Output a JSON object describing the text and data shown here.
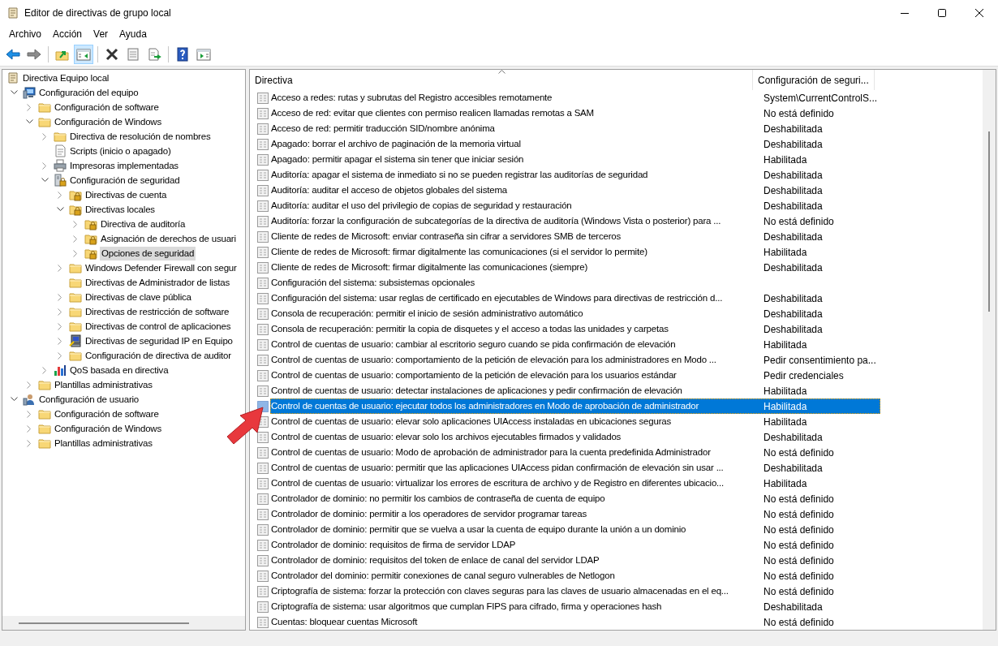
{
  "window": {
    "title": "Editor de directivas de grupo local"
  },
  "menu": [
    "Archivo",
    "Acción",
    "Ver",
    "Ayuda"
  ],
  "toolbar": [
    {
      "kind": "back",
      "pressed": false
    },
    {
      "kind": "forward",
      "pressed": false
    },
    {
      "kind": "sep"
    },
    {
      "kind": "up",
      "pressed": false
    },
    {
      "kind": "tree",
      "pressed": true
    },
    {
      "kind": "sep"
    },
    {
      "kind": "delete",
      "pressed": false
    },
    {
      "kind": "properties",
      "pressed": false
    },
    {
      "kind": "export",
      "pressed": false
    },
    {
      "kind": "sep"
    },
    {
      "kind": "help",
      "pressed": false
    },
    {
      "kind": "action",
      "pressed": false
    }
  ],
  "tree": [
    {
      "label": "Directiva Equipo local",
      "kind": "scroll",
      "selected": false,
      "children": [
        {
          "label": "Configuración del equipo",
          "kind": "computer",
          "expanded": true,
          "selected": false,
          "children": [
            {
              "label": "Configuración de software",
              "kind": "folder",
              "expanded": false,
              "selected": false
            },
            {
              "label": "Configuración de Windows",
              "kind": "folder",
              "expanded": true,
              "selected": false,
              "children": [
                {
                  "label": "Directiva de resolución de nombres",
                  "kind": "folder",
                  "expanded": false,
                  "selected": false
                },
                {
                  "label": "Scripts (inicio o apagado)",
                  "kind": "script",
                  "selected": false
                },
                {
                  "label": "Impresoras implementadas",
                  "kind": "printer",
                  "expanded": false,
                  "selected": false
                },
                {
                  "label": "Configuración de seguridad",
                  "kind": "server",
                  "expanded": true,
                  "selected": false,
                  "children": [
                    {
                      "label": "Directivas de cuenta",
                      "kind": "lockfolder",
                      "expanded": false,
                      "selected": false
                    },
                    {
                      "label": "Directivas locales",
                      "kind": "lockfolder",
                      "expanded": true,
                      "selected": false,
                      "children": [
                        {
                          "label": "Directiva de auditoría",
                          "kind": "lockfolder",
                          "expanded": false,
                          "selected": false
                        },
                        {
                          "label": "Asignación de derechos de usuari",
                          "kind": "lockfolder",
                          "expanded": false,
                          "selected": false
                        },
                        {
                          "label": "Opciones de seguridad",
                          "kind": "lockfolder",
                          "expanded": false,
                          "selected": true
                        }
                      ]
                    },
                    {
                      "label": "Windows Defender Firewall con segur",
                      "kind": "folder",
                      "expanded": false,
                      "selected": false
                    },
                    {
                      "label": "Directivas de Administrador de listas",
                      "kind": "folder",
                      "selected": false
                    },
                    {
                      "label": "Directivas de clave pública",
                      "kind": "folder",
                      "expanded": false,
                      "selected": false
                    },
                    {
                      "label": "Directivas de restricción de software",
                      "kind": "folder",
                      "expanded": false,
                      "selected": false
                    },
                    {
                      "label": "Directivas de control de aplicaciones",
                      "kind": "folder",
                      "expanded": false,
                      "selected": false
                    },
                    {
                      "label": "Directivas de seguridad IP en Equipo",
                      "kind": "ipsec",
                      "expanded": false,
                      "selected": false
                    },
                    {
                      "label": "Configuración de directiva de auditor",
                      "kind": "folder",
                      "expanded": false,
                      "selected": false
                    }
                  ]
                },
                {
                  "label": "QoS basada en directiva",
                  "kind": "chart",
                  "expanded": false,
                  "selected": false
                }
              ]
            },
            {
              "label": "Plantillas administrativas",
              "kind": "folder",
              "expanded": false,
              "selected": false
            }
          ]
        },
        {
          "label": "Configuración de usuario",
          "kind": "user",
          "expanded": true,
          "selected": false,
          "children": [
            {
              "label": "Configuración de software",
              "kind": "folder",
              "expanded": false,
              "selected": false
            },
            {
              "label": "Configuración de Windows",
              "kind": "folder",
              "expanded": false,
              "selected": false
            },
            {
              "label": "Plantillas administrativas",
              "kind": "folder",
              "expanded": false,
              "selected": false
            }
          ]
        }
      ]
    }
  ],
  "table": {
    "columns": [
      "Directiva",
      "Configuración de seguri..."
    ],
    "rows": [
      {
        "policy": "Acceso a redes: rutas y subrutas del Registro accesibles remotamente",
        "setting": "System\\CurrentControlS...",
        "selected": false
      },
      {
        "policy": "Acceso de red: evitar que clientes con permiso realicen llamadas remotas a SAM",
        "setting": "No está definido",
        "selected": false
      },
      {
        "policy": "Acceso de red: permitir traducción SID/nombre anónima",
        "setting": "Deshabilitada",
        "selected": false
      },
      {
        "policy": "Apagado: borrar el archivo de paginación de la memoria virtual",
        "setting": "Deshabilitada",
        "selected": false
      },
      {
        "policy": "Apagado: permitir apagar el sistema sin tener que iniciar sesión",
        "setting": "Habilitada",
        "selected": false
      },
      {
        "policy": "Auditoría: apagar el sistema de inmediato si no se pueden registrar las auditorías de seguridad",
        "setting": "Deshabilitada",
        "selected": false
      },
      {
        "policy": "Auditoría: auditar el acceso de objetos globales del sistema",
        "setting": "Deshabilitada",
        "selected": false
      },
      {
        "policy": "Auditoría: auditar el uso del privilegio de copias de seguridad y restauración",
        "setting": "Deshabilitada",
        "selected": false
      },
      {
        "policy": "Auditoría: forzar la configuración de subcategorías de la directiva de auditoría (Windows Vista o posterior) para ...",
        "setting": "No está definido",
        "selected": false
      },
      {
        "policy": "Cliente de redes de Microsoft: enviar contraseña sin cifrar a servidores SMB de terceros",
        "setting": "Deshabilitada",
        "selected": false
      },
      {
        "policy": "Cliente de redes de Microsoft: firmar digitalmente las comunicaciones (si el servidor lo permite)",
        "setting": "Habilitada",
        "selected": false
      },
      {
        "policy": "Cliente de redes de Microsoft: firmar digitalmente las comunicaciones (siempre)",
        "setting": "Deshabilitada",
        "selected": false
      },
      {
        "policy": "Configuración del sistema: subsistemas opcionales",
        "selected": false
      },
      {
        "policy": "Configuración del sistema: usar reglas de certificado en ejecutables de Windows para directivas de restricción d...",
        "setting": "Deshabilitada",
        "selected": false
      },
      {
        "policy": "Consola de recuperación: permitir el inicio de sesión administrativo automático",
        "setting": "Deshabilitada",
        "selected": false
      },
      {
        "policy": "Consola de recuperación: permitir la copia de disquetes y el acceso a todas las unidades y carpetas",
        "setting": "Deshabilitada",
        "selected": false
      },
      {
        "policy": "Control de cuentas de usuario: cambiar al escritorio seguro cuando se pida confirmación de elevación",
        "setting": "Habilitada",
        "selected": false
      },
      {
        "policy": "Control de cuentas de usuario: comportamiento de la petición de elevación para los administradores en Modo ...",
        "setting": "Pedir consentimiento pa...",
        "selected": false
      },
      {
        "policy": "Control de cuentas de usuario: comportamiento de la petición de elevación para los usuarios estándar",
        "setting": "Pedir credenciales",
        "selected": false
      },
      {
        "policy": "Control de cuentas de usuario: detectar instalaciones de aplicaciones y pedir confirmación de elevación",
        "setting": "Habilitada",
        "selected": false
      },
      {
        "policy": "Control de cuentas de usuario: ejecutar todos los administradores en Modo de aprobación de administrador",
        "setting": "Habilitada",
        "selected": true
      },
      {
        "policy": "Control de cuentas de usuario: elevar solo aplicaciones UIAccess instaladas en ubicaciones seguras",
        "setting": "Habilitada",
        "selected": false
      },
      {
        "policy": "Control de cuentas de usuario: elevar solo los archivos ejecutables firmados y validados",
        "setting": "Deshabilitada",
        "selected": false
      },
      {
        "policy": "Control de cuentas de usuario: Modo de aprobación de administrador para la cuenta predefinida Administrador",
        "setting": "No está definido",
        "selected": false
      },
      {
        "policy": "Control de cuentas de usuario: permitir que las aplicaciones UIAccess pidan confirmación de elevación sin usar ...",
        "setting": "Deshabilitada",
        "selected": false
      },
      {
        "policy": "Control de cuentas de usuario: virtualizar los errores de escritura de archivo y de Registro en diferentes ubicacio...",
        "setting": "Habilitada",
        "selected": false
      },
      {
        "policy": "Controlador de dominio: no permitir los cambios de contraseña de cuenta de equipo",
        "setting": "No está definido",
        "selected": false
      },
      {
        "policy": "Controlador de dominio: permitir a los operadores de servidor programar tareas",
        "setting": "No está definido",
        "selected": false
      },
      {
        "policy": "Controlador de dominio: permitir que se vuelva a usar la cuenta de equipo durante la unión a un dominio",
        "setting": "No está definido",
        "selected": false
      },
      {
        "policy": "Controlador de dominio: requisitos de firma de servidor LDAP",
        "setting": "No está definido",
        "selected": false
      },
      {
        "policy": "Controlador de dominio: requisitos del token de enlace de canal del servidor LDAP",
        "setting": "No está definido",
        "selected": false
      },
      {
        "policy": "Controlador del dominio: permitir conexiones de canal seguro vulnerables de Netlogon",
        "setting": "No está definido",
        "selected": false
      },
      {
        "policy": "Criptografía de sistema: forzar la protección con claves seguras para las claves de usuario almacenadas en el eq...",
        "setting": "No está definido",
        "selected": false
      },
      {
        "policy": "Criptografía de sistema: usar algoritmos que cumplan FIPS para cifrado, firma y operaciones hash",
        "setting": "Deshabilitada",
        "selected": false
      },
      {
        "policy": "Cuentas: bloquear cuentas Microsoft",
        "setting": "No está definido",
        "selected": false
      }
    ]
  }
}
